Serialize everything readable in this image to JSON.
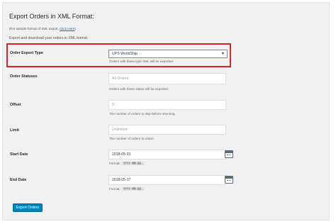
{
  "page": {
    "title": "Export Orders in XML Format:",
    "sample_note_prefix": "(For sample format of XML export, ",
    "sample_note_link": "Click Here",
    "sample_note_suffix": ")",
    "description": "Export and download your orders in XML format."
  },
  "order_export_type": {
    "label": "Order Export Type",
    "value": "UPS WorldShip",
    "hint": "Orders with these type XML will be exported."
  },
  "order_statuses": {
    "label": "Order Statuses",
    "placeholder": "All Orders",
    "hint": "Orders with these status will be exported."
  },
  "offset": {
    "label": "Offset",
    "value": "0",
    "hint": "The number of orders to skip before returning."
  },
  "limit": {
    "label": "Limit",
    "placeholder": "Unlimited",
    "hint": "The number of orders to return."
  },
  "start_date": {
    "label": "Start Date",
    "value": "2018-05-01",
    "format_label": "Format:",
    "format_value": "YYYY-MM-DD."
  },
  "end_date": {
    "label": "End Date",
    "value": "2018-05-17",
    "format_label": "Format:",
    "format_value": "YYYY-MM-DD."
  },
  "actions": {
    "export_label": "Export Orders"
  },
  "colors": {
    "highlight": "#d9262b",
    "primary_button": "#0085ba",
    "link": "#0073aa"
  }
}
